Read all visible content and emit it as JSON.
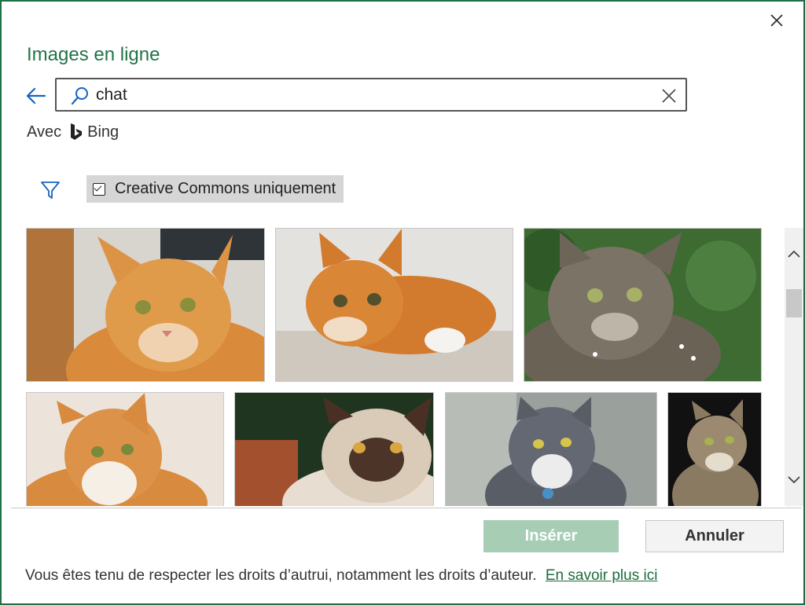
{
  "dialog": {
    "title": "Images en ligne",
    "close_icon": "close-icon"
  },
  "search": {
    "value": "chat",
    "placeholder": "",
    "icon": "search-icon",
    "clear_icon": "clear-icon",
    "back_icon": "back-arrow-icon"
  },
  "provider": {
    "prefix": "Avec",
    "name": "Bing",
    "icon": "bing-logo-icon"
  },
  "filters": {
    "filter_icon": "filter-icon",
    "creative_commons_label": "Creative Commons uniquement",
    "creative_commons_checked": true
  },
  "results": [
    {
      "name": "orange-tabby-cat-portrait"
    },
    {
      "name": "orange-cat-lying-down"
    },
    {
      "name": "wild-cat-in-grass"
    },
    {
      "name": "orange-white-cat-closeup"
    },
    {
      "name": "himalayan-cat-portrait"
    },
    {
      "name": "gray-white-cat-with-blue-tag"
    },
    {
      "name": "tabby-cat-side-profile"
    }
  ],
  "buttons": {
    "insert_label": "Insérer",
    "cancel_label": "Annuler"
  },
  "footer": {
    "notice": "Vous êtes tenu de respecter les droits d’autrui, notamment les droits d’auteur.",
    "link_label": "En savoir plus ici"
  },
  "colors": {
    "accent": "#217346",
    "insert_button_bg": "#a7cdb5",
    "link": "#1e6b3b",
    "back_arrow": "#1565c0",
    "search_icon": "#1565c0",
    "filter_icon": "#1565c0"
  }
}
